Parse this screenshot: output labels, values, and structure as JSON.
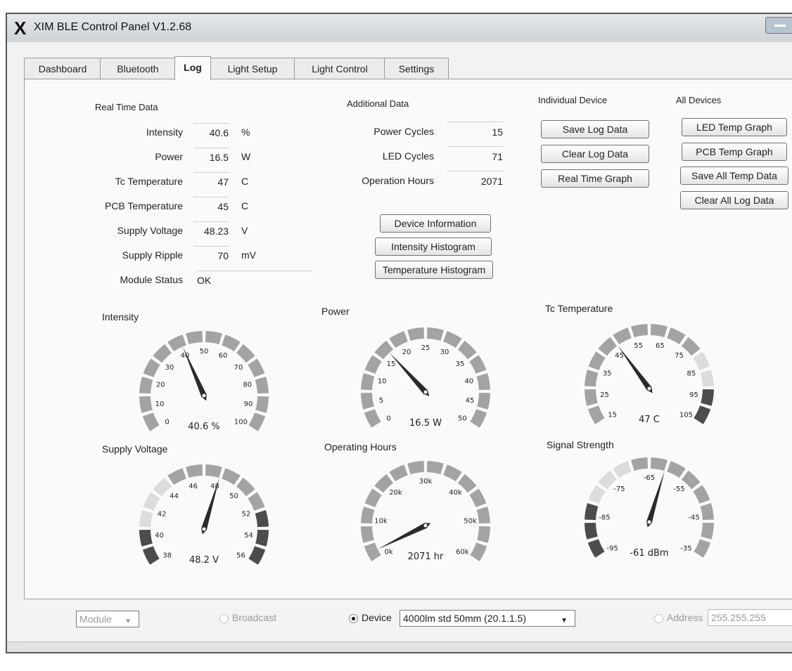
{
  "window": {
    "title": "XIM BLE Control Panel V1.2.68",
    "logo": "X"
  },
  "tabs": [
    {
      "label": "Dashboard"
    },
    {
      "label": "Bluetooth"
    },
    {
      "label": "Log"
    },
    {
      "label": "Light Setup"
    },
    {
      "label": "Light Control"
    },
    {
      "label": "Settings"
    }
  ],
  "real_time": {
    "title": "Real Time Data",
    "rows": [
      {
        "label": "Intensity",
        "value": "40.6",
        "unit": "%"
      },
      {
        "label": "Power",
        "value": "16.5",
        "unit": "W"
      },
      {
        "label": "Tc Temperature",
        "value": "47",
        "unit": "C"
      },
      {
        "label": "PCB Temperature",
        "value": "45",
        "unit": "C"
      },
      {
        "label": "Supply Voltage",
        "value": "48.23",
        "unit": "V"
      },
      {
        "label": "Supply Ripple",
        "value": "70",
        "unit": "mV"
      },
      {
        "label": "Module Status",
        "value": "OK",
        "unit": ""
      }
    ]
  },
  "additional": {
    "title": "Additional Data",
    "rows": [
      {
        "label": "Power Cycles",
        "value": "15"
      },
      {
        "label": "LED Cycles",
        "value": "71"
      },
      {
        "label": "Operation Hours",
        "value": "2071"
      }
    ],
    "buttons": [
      "Device Information",
      "Intensity Histogram",
      "Temperature Histogram"
    ]
  },
  "individual": {
    "title": "Individual Device",
    "buttons": [
      "Save Log Data",
      "Clear Log Data",
      "Real Time Graph"
    ]
  },
  "all_devices": {
    "title": "All Devices",
    "buttons": [
      "LED Temp Graph",
      "PCB Temp Graph",
      "Save All Temp Data",
      "Clear All Log Data"
    ]
  },
  "gauges": [
    {
      "title": "Intensity",
      "min": 0,
      "max": 100,
      "value": 40.6,
      "readout": "40.6 %",
      "ticks": [
        "0",
        "10",
        "20",
        "30",
        "40",
        "50",
        "60",
        "70",
        "80",
        "90",
        "100"
      ],
      "highlight": "none"
    },
    {
      "title": "Power",
      "min": 0,
      "max": 50,
      "value": 16.5,
      "readout": "16.5 W",
      "ticks": [
        "0",
        "5",
        "10",
        "15",
        "20",
        "25",
        "30",
        "35",
        "40",
        "45",
        "50"
      ],
      "highlight": "none"
    },
    {
      "title": "Tc Temperature",
      "min": 15,
      "max": 105,
      "value": 47,
      "readout": "47 C",
      "ticks": [
        "15",
        "25",
        "35",
        "45",
        "55",
        "65",
        "75",
        "85",
        "95",
        "105"
      ],
      "highlight": "high"
    },
    {
      "title": "Supply Voltage",
      "min": 38,
      "max": 56,
      "value": 48.2,
      "readout": "48.2 V",
      "ticks": [
        "38",
        "40",
        "42",
        "44",
        "46",
        "48",
        "50",
        "52",
        "54",
        "56"
      ],
      "highlight": "both"
    },
    {
      "title": "Operating Hours",
      "min": 0,
      "max": 60,
      "value": 2.071,
      "readout": "2071 hr",
      "ticks": [
        "0k",
        "10k",
        "20k",
        "30k",
        "40k",
        "50k",
        "60k"
      ],
      "highlight": "none"
    },
    {
      "title": "Signal Strength",
      "min": -95,
      "max": -35,
      "value": -61,
      "readout": "-61 dBm",
      "ticks": [
        "-95",
        "-85",
        "-75",
        "-65",
        "-55",
        "-45",
        "-35"
      ],
      "highlight": "low"
    }
  ],
  "colors": {
    "gauge_mid": "#a3a3a3",
    "gauge_light": "#dcdcdc",
    "gauge_dark": "#4c4c4c",
    "needle": "#2a2a2a"
  },
  "bottom": {
    "module_select": "Module",
    "broadcast_label": "Broadcast",
    "device_label": "Device",
    "device_value": "4000lm std 50mm (20.1.1.5)",
    "address_label": "Address",
    "address_value": "255.255.255"
  }
}
